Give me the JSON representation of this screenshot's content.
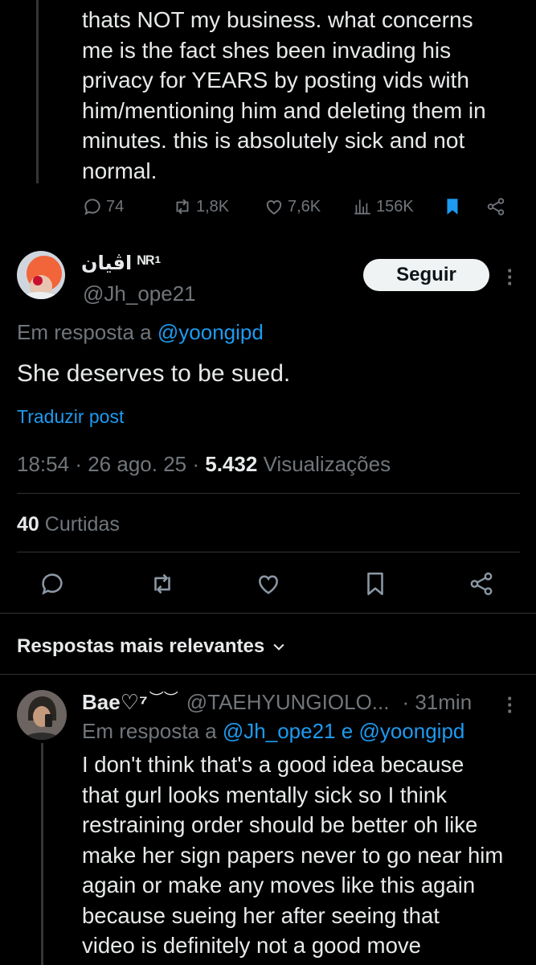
{
  "previous_tweet": {
    "text_lines": [
      "thats NOT my business. what concerns",
      "me is the fact shes been invading his",
      "privacy for YEARS by posting vids with",
      "him/mentioning him and deleting them in",
      "minutes. this is absolutely sick and not",
      "normal."
    ],
    "replies": "74",
    "retweets": "1,8K",
    "likes": "7,6K",
    "views": "156K"
  },
  "main_tweet": {
    "display_name": "اڤيان ᴺᴿ¹",
    "handle": "@Jh_ope21",
    "follow_label": "Seguir",
    "reply_prefix": "Em resposta a",
    "reply_to": "@yoongipd",
    "text": "She deserves to be sued.",
    "translate_label": "Traduzir post",
    "time": "18:54",
    "sep1": "·",
    "date": "26 ago. 25",
    "sep2": "·",
    "views_count": "5.432",
    "views_label": "Visualizações",
    "likes_count": "40",
    "likes_label": "Curtidas"
  },
  "replies_section": {
    "sort_label": "Respostas mais relevantes"
  },
  "reply_tweet": {
    "display_name": "Bae♡⁷",
    "name_decor": "︶︶",
    "handle": "@TAEHYUNGIOLO...",
    "time": "· 31min",
    "reply_prefix": "Em resposta a",
    "reply_to_1": "@Jh_ope21",
    "reply_join": "e",
    "reply_to_2": "@yoongipd",
    "text_lines": [
      "I don't think that's a good idea because",
      "that gurl looks mentally sick so I think",
      "restraining order should be better oh like",
      "make her sign papers never to go near him",
      "again or make any moves like this again",
      "because sueing her after seeing that",
      "video is definitely not a good move"
    ]
  },
  "colors": {
    "background": "#000000",
    "text": "#e7e9ea",
    "muted": "#71767b",
    "link": "#1d9bf0",
    "bookmark_active": "#1d9bf0"
  }
}
